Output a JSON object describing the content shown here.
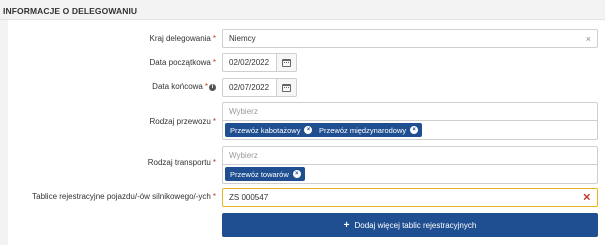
{
  "section": {
    "title": "INFORMACJE O DELEGOWANIU"
  },
  "fields": {
    "country": {
      "label": "Kraj delegowania",
      "value": "Niemcy",
      "clear": "×"
    },
    "start_date": {
      "label": "Data początkowa",
      "value": "02/02/2022"
    },
    "end_date": {
      "label": "Data końcowa",
      "value": "02/07/2022",
      "info_icon": "info-icon"
    },
    "transport_kind": {
      "label": "Rodzaj przewozu",
      "placeholder": "Wybierz",
      "tags": [
        "Przewóz kabotażowy",
        "Przewóz międzynarodowy"
      ]
    },
    "transport_type": {
      "label": "Rodzaj transportu",
      "placeholder": "Wybierz",
      "tags": [
        "Przewóz towarów"
      ]
    },
    "plates": {
      "label": "Tablice rejestracyjne pojazdu/-ów silnikowego/-ych",
      "value": "ZS 000547",
      "clear": "✕"
    }
  },
  "required_mark": "*",
  "tag_remove": "×",
  "add_button": {
    "icon": "plus-icon",
    "label": "Dodaj więcej tablic rejestracyjnych",
    "plus": "+"
  },
  "colors": {
    "accent": "#1f4f91",
    "required": "#c0392b",
    "highlight_border": "#e8b422"
  }
}
